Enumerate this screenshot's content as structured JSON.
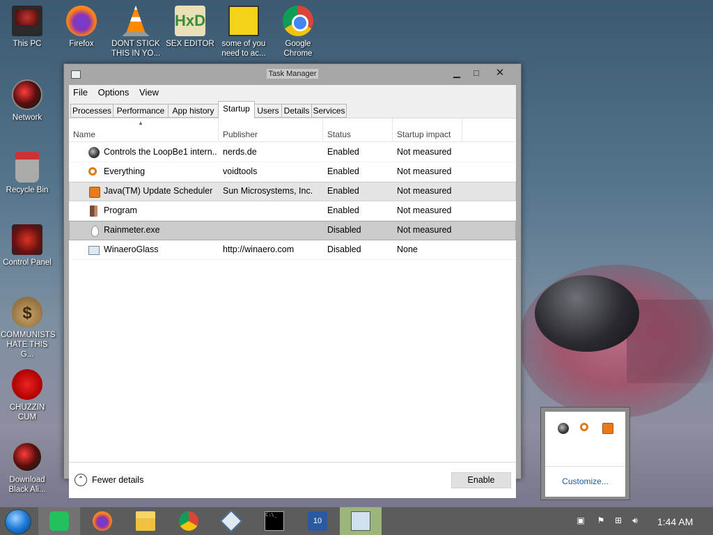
{
  "desktop": {
    "icons": [
      {
        "label": "This PC"
      },
      {
        "label": "Firefox"
      },
      {
        "label": "DONT STICK THIS IN YO..."
      },
      {
        "label": "SEX EDITOR"
      },
      {
        "label": "some of you need to ac..."
      },
      {
        "label": "Google Chrome"
      },
      {
        "label": "Network"
      },
      {
        "label": "Recycle Bin"
      },
      {
        "label": "Control Panel"
      },
      {
        "label": "COMMUNISTS HATE THIS G..."
      },
      {
        "label": "CHUZZIN CUM"
      },
      {
        "label": "Download Black Ali..."
      }
    ],
    "hxd_text": "HxD",
    "bag_text": "$"
  },
  "task_manager": {
    "title": "Task Manager",
    "menu": [
      "File",
      "Options",
      "View"
    ],
    "tabs": [
      "Processes",
      "Performance",
      "App history",
      "Startup",
      "Users",
      "Details",
      "Services"
    ],
    "active_tab": "Startup",
    "columns": [
      "Name",
      "Publisher",
      "Status",
      "Startup impact"
    ],
    "rows": [
      {
        "name": "Controls the LoopBe1 intern...",
        "publisher": "nerds.de",
        "status": "Enabled",
        "impact": "Not measured",
        "icon": "loopbe-icon"
      },
      {
        "name": "Everything",
        "publisher": "voidtools",
        "status": "Enabled",
        "impact": "Not measured",
        "icon": "everything-search-icon"
      },
      {
        "name": "Java(TM) Update Scheduler",
        "publisher": "Sun Microsystems, Inc.",
        "status": "Enabled",
        "impact": "Not measured",
        "icon": "java-icon"
      },
      {
        "name": "Program",
        "publisher": "",
        "status": "Enabled",
        "impact": "Not measured",
        "icon": "program-icon"
      },
      {
        "name": "Rainmeter.exe",
        "publisher": "",
        "status": "Disabled",
        "impact": "Not measured",
        "icon": "rainmeter-drop-icon"
      },
      {
        "name": "WinaeroGlass",
        "publisher": "http://winaero.com",
        "status": "Disabled",
        "impact": "None",
        "icon": "winaero-window-icon"
      }
    ],
    "fewer_details": "Fewer details",
    "enable_button": "Enable"
  },
  "tray_flyout": {
    "customize": "Customize..."
  },
  "taskbar": {
    "pinned": [
      "Spotify",
      "Firefox",
      "File Explorer",
      "Google Chrome",
      "VirtualBox",
      "Command Prompt",
      "Windows 10 app",
      "Task Manager"
    ],
    "cmd_text": "C:\\_",
    "win10_text": "10",
    "clock": "1:44 AM"
  }
}
